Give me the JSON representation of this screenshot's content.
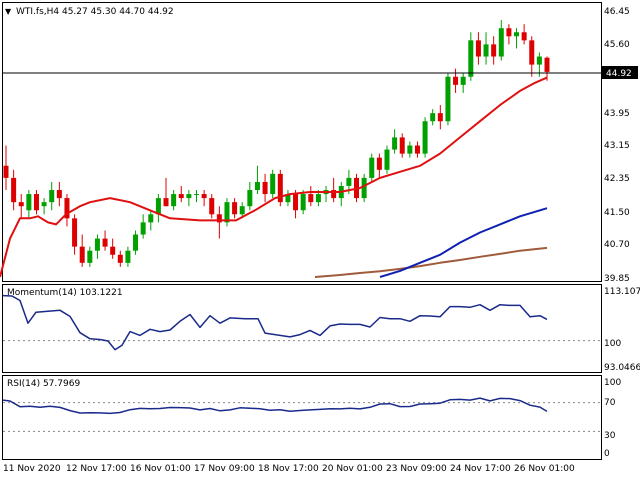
{
  "header": {
    "symbol_line": "WTI.fs,H4  45.27 45.30 44.70 44.92",
    "momentum_label": "Momentum(14) 103.1221",
    "rsi_label": "RSI(14) 57.7969",
    "current_price_label": "44.92"
  },
  "colors": {
    "bull_candle": "#00a000",
    "bear_candle": "#dd0000",
    "ma_fast": "#e01010",
    "ma_mid": "#1020b0",
    "ma_slow": "#a05a3c",
    "indicator_line": "#1a2a8a",
    "grid_dash": "#888888"
  },
  "chart_data": [
    {
      "type": "candlestick",
      "name": "price",
      "yticks": [
        "46.45",
        "45.60",
        "44.92",
        "43.95",
        "43.15",
        "42.35",
        "41.50",
        "40.70",
        "39.85"
      ],
      "ylim": [
        39.85,
        46.45
      ],
      "current_price": 44.92,
      "candles": [
        [
          42.6,
          43.1,
          42.0,
          42.3
        ],
        [
          42.3,
          42.5,
          41.5,
          41.7
        ],
        [
          41.7,
          41.9,
          41.3,
          41.6
        ],
        [
          41.5,
          42.0,
          41.3,
          41.9
        ],
        [
          41.9,
          42.0,
          41.4,
          41.5
        ],
        [
          41.6,
          41.8,
          41.4,
          41.7
        ],
        [
          41.7,
          42.2,
          41.5,
          42.0
        ],
        [
          42.0,
          42.2,
          41.6,
          41.8
        ],
        [
          41.8,
          41.9,
          41.1,
          41.3
        ],
        [
          41.3,
          41.4,
          40.4,
          40.6
        ],
        [
          40.6,
          40.9,
          40.1,
          40.2
        ],
        [
          40.2,
          40.6,
          40.1,
          40.5
        ],
        [
          40.5,
          40.9,
          40.3,
          40.8
        ],
        [
          40.8,
          41.0,
          40.5,
          40.6
        ],
        [
          40.6,
          40.8,
          40.3,
          40.4
        ],
        [
          40.4,
          40.5,
          40.1,
          40.2
        ],
        [
          40.2,
          40.6,
          40.1,
          40.5
        ],
        [
          40.5,
          41.0,
          40.4,
          40.9
        ],
        [
          40.9,
          41.4,
          40.8,
          41.2
        ],
        [
          41.2,
          41.5,
          41.0,
          41.4
        ],
        [
          41.4,
          41.9,
          41.2,
          41.8
        ],
        [
          41.8,
          42.3,
          41.6,
          41.6
        ],
        [
          41.6,
          42.0,
          41.5,
          41.9
        ],
        [
          41.9,
          42.1,
          41.7,
          41.8
        ],
        [
          41.8,
          42.0,
          41.6,
          41.9
        ],
        [
          41.9,
          42.0,
          41.7,
          41.9
        ],
        [
          41.9,
          42.0,
          41.6,
          41.8
        ],
        [
          41.8,
          41.9,
          41.3,
          41.4
        ],
        [
          41.4,
          41.6,
          40.8,
          41.2
        ],
        [
          41.2,
          41.8,
          41.1,
          41.7
        ],
        [
          41.7,
          41.8,
          41.3,
          41.4
        ],
        [
          41.4,
          41.7,
          41.3,
          41.6
        ],
        [
          41.6,
          42.2,
          41.5,
          42.0
        ],
        [
          42.0,
          42.6,
          41.9,
          42.2
        ],
        [
          42.2,
          42.4,
          41.7,
          41.9
        ],
        [
          41.9,
          42.5,
          41.8,
          42.4
        ],
        [
          42.4,
          42.5,
          41.6,
          41.7
        ],
        [
          41.7,
          42.0,
          41.6,
          41.9
        ],
        [
          41.9,
          42.0,
          41.3,
          41.5
        ],
        [
          41.5,
          42.0,
          41.4,
          41.9
        ],
        [
          41.9,
          42.1,
          41.6,
          41.7
        ],
        [
          41.7,
          42.0,
          41.6,
          41.9
        ],
        [
          41.9,
          42.1,
          41.7,
          42.0
        ],
        [
          42.0,
          42.3,
          41.7,
          41.8
        ],
        [
          41.8,
          42.2,
          41.6,
          42.1
        ],
        [
          42.1,
          42.5,
          41.9,
          42.3
        ],
        [
          42.3,
          42.4,
          41.7,
          41.8
        ],
        [
          41.8,
          42.4,
          41.7,
          42.3
        ],
        [
          42.3,
          42.9,
          42.2,
          42.8
        ],
        [
          42.8,
          42.9,
          42.3,
          42.5
        ],
        [
          42.5,
          43.1,
          42.4,
          43.0
        ],
        [
          43.0,
          43.5,
          42.9,
          43.3
        ],
        [
          43.3,
          43.4,
          42.8,
          42.9
        ],
        [
          42.9,
          43.2,
          42.8,
          43.1
        ],
        [
          43.1,
          43.2,
          42.8,
          42.9
        ],
        [
          42.9,
          43.8,
          42.8,
          43.7
        ],
        [
          43.7,
          44.0,
          43.6,
          43.9
        ],
        [
          43.9,
          44.1,
          43.5,
          43.7
        ],
        [
          43.7,
          44.9,
          43.6,
          44.8
        ],
        [
          44.8,
          45.0,
          44.4,
          44.6
        ],
        [
          44.6,
          44.9,
          44.4,
          44.8
        ],
        [
          44.8,
          45.9,
          44.7,
          45.7
        ],
        [
          45.7,
          45.9,
          45.1,
          45.3
        ],
        [
          45.3,
          45.9,
          45.1,
          45.6
        ],
        [
          45.6,
          45.8,
          45.1,
          45.3
        ],
        [
          45.3,
          46.2,
          45.2,
          46.0
        ],
        [
          46.0,
          46.1,
          45.6,
          45.8
        ],
        [
          45.8,
          46.0,
          45.5,
          45.9
        ],
        [
          45.9,
          46.1,
          45.6,
          45.7
        ],
        [
          45.7,
          45.8,
          44.8,
          45.1
        ],
        [
          45.1,
          45.4,
          44.8,
          45.3
        ],
        [
          45.27,
          45.3,
          44.7,
          44.92
        ]
      ],
      "ma_fast": [
        [
          0,
          39.85
        ],
        [
          10,
          40.8
        ],
        [
          20,
          41.3
        ],
        [
          30,
          41.3
        ],
        [
          38,
          41.35
        ],
        [
          48,
          41.2
        ],
        [
          56,
          41.15
        ],
        [
          66,
          41.4
        ],
        [
          80,
          41.6
        ],
        [
          90,
          41.7
        ],
        [
          110,
          41.8
        ],
        [
          130,
          41.7
        ],
        [
          150,
          41.5
        ],
        [
          170,
          41.3
        ],
        [
          200,
          41.25
        ],
        [
          236,
          41.25
        ],
        [
          255,
          41.5
        ],
        [
          275,
          41.8
        ],
        [
          290,
          41.9
        ],
        [
          310,
          41.95
        ],
        [
          340,
          41.95
        ],
        [
          360,
          42.05
        ],
        [
          380,
          42.3
        ],
        [
          400,
          42.45
        ],
        [
          420,
          42.6
        ],
        [
          440,
          42.9
        ],
        [
          460,
          43.3
        ],
        [
          480,
          43.7
        ],
        [
          500,
          44.1
        ],
        [
          520,
          44.45
        ],
        [
          535,
          44.65
        ],
        [
          547,
          44.78
        ]
      ],
      "ma_mid": [
        [
          380,
          39.85
        ],
        [
          400,
          40.0
        ],
        [
          420,
          40.2
        ],
        [
          440,
          40.4
        ],
        [
          460,
          40.7
        ],
        [
          480,
          40.95
        ],
        [
          500,
          41.15
        ],
        [
          520,
          41.35
        ],
        [
          540,
          41.5
        ],
        [
          547,
          41.55
        ]
      ],
      "ma_slow": [
        [
          315,
          39.85
        ],
        [
          340,
          39.9
        ],
        [
          360,
          39.95
        ],
        [
          380,
          39.99
        ],
        [
          400,
          40.05
        ],
        [
          420,
          40.12
        ],
        [
          440,
          40.2
        ],
        [
          460,
          40.27
        ],
        [
          480,
          40.35
        ],
        [
          500,
          40.42
        ],
        [
          520,
          40.5
        ],
        [
          547,
          40.57
        ]
      ]
    },
    {
      "type": "line",
      "name": "momentum",
      "yticks": [
        "113.1076",
        "100",
        "93.0466"
      ],
      "ylim": [
        93.0466,
        113.1076
      ],
      "points": [
        [
          3,
          111.9
        ],
        [
          12,
          111.8
        ],
        [
          20,
          110.6
        ],
        [
          28,
          104.6
        ],
        [
          36,
          107.5
        ],
        [
          45,
          107.7
        ],
        [
          60,
          108.0
        ],
        [
          70,
          106.4
        ],
        [
          80,
          102.1
        ],
        [
          90,
          100.5
        ],
        [
          100,
          100.3
        ],
        [
          108,
          99.9
        ],
        [
          115,
          97.6
        ],
        [
          122,
          98.8
        ],
        [
          130,
          102.4
        ],
        [
          140,
          101.4
        ],
        [
          150,
          103.0
        ],
        [
          160,
          102.4
        ],
        [
          170,
          102.8
        ],
        [
          180,
          105.1
        ],
        [
          190,
          106.9
        ],
        [
          200,
          103.5
        ],
        [
          210,
          106.6
        ],
        [
          220,
          104.6
        ],
        [
          230,
          106.0
        ],
        [
          245,
          105.8
        ],
        [
          258,
          105.8
        ],
        [
          265,
          102.0
        ],
        [
          275,
          101.6
        ],
        [
          290,
          101.0
        ],
        [
          300,
          101.6
        ],
        [
          310,
          102.7
        ],
        [
          320,
          101.4
        ],
        [
          330,
          103.9
        ],
        [
          340,
          104.4
        ],
        [
          350,
          104.3
        ],
        [
          360,
          104.3
        ],
        [
          370,
          103.6
        ],
        [
          380,
          106.1
        ],
        [
          390,
          105.8
        ],
        [
          400,
          105.8
        ],
        [
          410,
          105.1
        ],
        [
          420,
          106.6
        ],
        [
          430,
          106.5
        ],
        [
          440,
          106.3
        ],
        [
          450,
          109.0
        ],
        [
          460,
          109.0
        ],
        [
          470,
          108.8
        ],
        [
          480,
          109.5
        ],
        [
          490,
          108.0
        ],
        [
          500,
          109.5
        ],
        [
          510,
          109.3
        ],
        [
          520,
          109.3
        ],
        [
          530,
          106.3
        ],
        [
          540,
          106.6
        ],
        [
          547,
          105.6
        ]
      ]
    },
    {
      "type": "line",
      "name": "rsi",
      "yticks": [
        "100",
        "70",
        "30",
        "0"
      ],
      "ylim": [
        0,
        100
      ],
      "levels": [
        70,
        30
      ],
      "points": [
        [
          3,
          73.5
        ],
        [
          10,
          72.2
        ],
        [
          20,
          64.3
        ],
        [
          30,
          64.9
        ],
        [
          40,
          63.5
        ],
        [
          50,
          64.9
        ],
        [
          60,
          63.4
        ],
        [
          70,
          58.9
        ],
        [
          80,
          55.5
        ],
        [
          90,
          56.0
        ],
        [
          100,
          55.7
        ],
        [
          110,
          55.0
        ],
        [
          120,
          56.2
        ],
        [
          130,
          60.2
        ],
        [
          140,
          62.0
        ],
        [
          150,
          61.5
        ],
        [
          160,
          61.8
        ],
        [
          170,
          63.2
        ],
        [
          180,
          63.1
        ],
        [
          190,
          62.5
        ],
        [
          200,
          59.9
        ],
        [
          210,
          61.8
        ],
        [
          220,
          58.6
        ],
        [
          230,
          59.9
        ],
        [
          240,
          62.8
        ],
        [
          250,
          62.2
        ],
        [
          260,
          61.5
        ],
        [
          270,
          59.4
        ],
        [
          280,
          60.1
        ],
        [
          290,
          57.9
        ],
        [
          300,
          59.0
        ],
        [
          310,
          59.9
        ],
        [
          320,
          60.5
        ],
        [
          330,
          61.5
        ],
        [
          340,
          61.2
        ],
        [
          350,
          62.2
        ],
        [
          360,
          61.2
        ],
        [
          370,
          63.5
        ],
        [
          380,
          68.1
        ],
        [
          390,
          68.5
        ],
        [
          400,
          64.5
        ],
        [
          410,
          64.6
        ],
        [
          420,
          68.0
        ],
        [
          430,
          68.3
        ],
        [
          440,
          69.1
        ],
        [
          450,
          73.9
        ],
        [
          460,
          74.4
        ],
        [
          470,
          73.5
        ],
        [
          480,
          76.2
        ],
        [
          490,
          72.4
        ],
        [
          500,
          75.9
        ],
        [
          510,
          75.5
        ],
        [
          520,
          72.8
        ],
        [
          530,
          66.4
        ],
        [
          540,
          63.8
        ],
        [
          547,
          57.8
        ]
      ]
    }
  ],
  "xaxis": {
    "labels": [
      "11 Nov 2020",
      "12 Nov 17:00",
      "16 Nov 01:00",
      "17 Nov 09:00",
      "18 Nov 17:00",
      "20 Nov 01:00",
      "23 Nov 09:00",
      "24 Nov 17:00",
      "26 Nov 01:00"
    ]
  }
}
